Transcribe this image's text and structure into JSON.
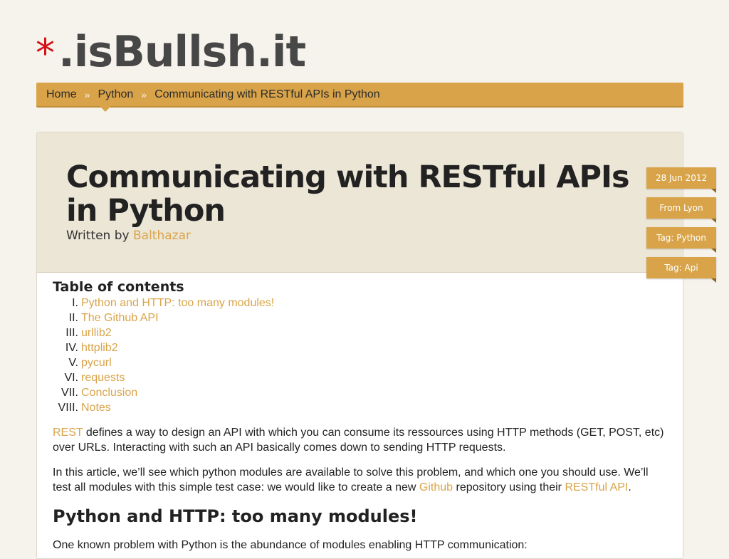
{
  "site": {
    "star": "*",
    "name": ".isBullsh.it"
  },
  "breadcrumb": [
    {
      "label": "Home"
    },
    {
      "label": "Python"
    },
    {
      "label": "Communicating with RESTful APIs in Python"
    }
  ],
  "breadcrumb_sep": "»",
  "article": {
    "title": "Communicating with RESTful APIs in Python",
    "byline_prefix": "Written by",
    "author": "Balthazar"
  },
  "meta_tags": [
    "28 Jun 2012",
    "From Lyon",
    "Tag: Python",
    "Tag: Api"
  ],
  "toc": {
    "title": "Table of contents",
    "items": [
      {
        "num": "I.",
        "label": "Python and HTTP: too many modules!"
      },
      {
        "num": "II.",
        "label": "The Github API"
      },
      {
        "num": "III.",
        "label": "urllib2"
      },
      {
        "num": "IV.",
        "label": "httplib2"
      },
      {
        "num": "V.",
        "label": "pycurl"
      },
      {
        "num": "VI.",
        "label": "requests"
      },
      {
        "num": "VII.",
        "label": "Conclusion"
      },
      {
        "num": "VIII.",
        "label": "Notes"
      }
    ]
  },
  "intro1": {
    "link": "REST",
    "text": " defines a way to design an API with which you can consume its ressources using HTTP methods (GET, POST, etc) over URLs. Interacting with such an API basically comes down to sending HTTP requests."
  },
  "intro2": {
    "text1": "In this article, we’ll see which python modules are available to solve this problem, and which one you should use. We’ll test all modules with this simple test case: we would like to create a new ",
    "link1": "Github",
    "text2": " repository using their ",
    "link2": "RESTful API",
    "text3": "."
  },
  "section1": {
    "title": "Python and HTTP: too many modules!",
    "text": "One known problem with Python is the abundance of modules enabling HTTP communication:"
  },
  "colors": {
    "accent": "#d9a449",
    "star": "#d3131a",
    "header_bg": "#ece6d6",
    "page_bg": "#f6f3ec"
  }
}
